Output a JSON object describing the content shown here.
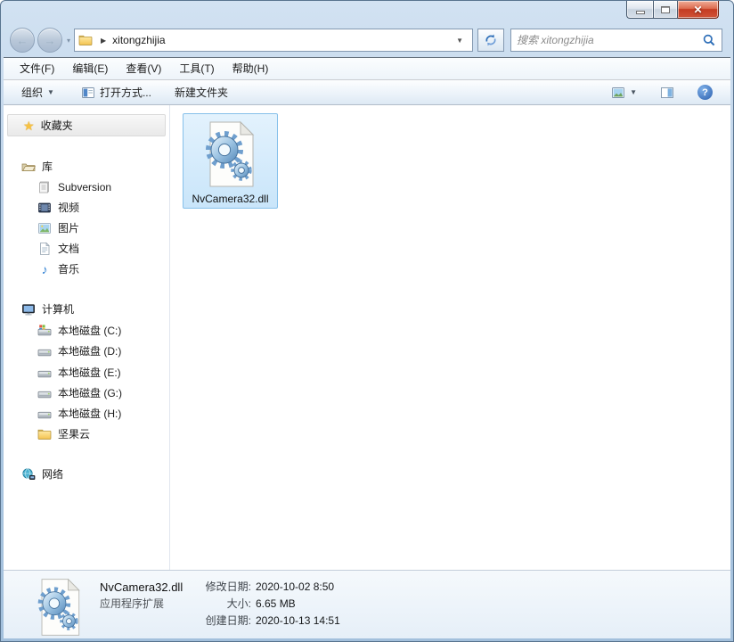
{
  "icons": {
    "star": "★",
    "back_arrow": "←",
    "forward_arrow": "→",
    "chevron_down": "▾",
    "breadcrumb_arrow": "▶",
    "dropdown_arrow": "▼",
    "music_note": "♪",
    "close_glyph": "✕",
    "help_mark": "?"
  },
  "navbar": {
    "address_path": "xitongzhijia",
    "search_placeholder": "搜索 xitongzhijia"
  },
  "menubar": {
    "items": [
      "文件(F)",
      "编辑(E)",
      "查看(V)",
      "工具(T)",
      "帮助(H)"
    ]
  },
  "toolbar": {
    "organize": "组织",
    "open_with": "打开方式...",
    "new_folder": "新建文件夹"
  },
  "sidebar": {
    "favorites": "收藏夹",
    "libraries": {
      "label": "库",
      "items": [
        "Subversion",
        "视频",
        "图片",
        "文档",
        "音乐"
      ]
    },
    "computer": {
      "label": "计算机",
      "items": [
        "本地磁盘 (C:)",
        "本地磁盘 (D:)",
        "本地磁盘 (E:)",
        "本地磁盘 (G:)",
        "本地磁盘 (H:)",
        "坚果云"
      ]
    },
    "network": {
      "label": "网络"
    }
  },
  "content": {
    "file": {
      "name": "NvCamera32.dll"
    }
  },
  "details": {
    "name": "NvCamera32.dll",
    "type": "应用程序扩展",
    "modified_label": "修改日期:",
    "modified_value": "2020-10-02 8:50",
    "size_label": "大小:",
    "size_value": "6.65 MB",
    "created_label": "创建日期:",
    "created_value": "2020-10-13 14:51"
  },
  "colors": {
    "aero_glass": "#aac6e0",
    "selection_fill": "#c9e5fa",
    "selection_border": "#86c0ea",
    "close_red": "#c43b22",
    "accent_blue": "#2f6fb8"
  }
}
